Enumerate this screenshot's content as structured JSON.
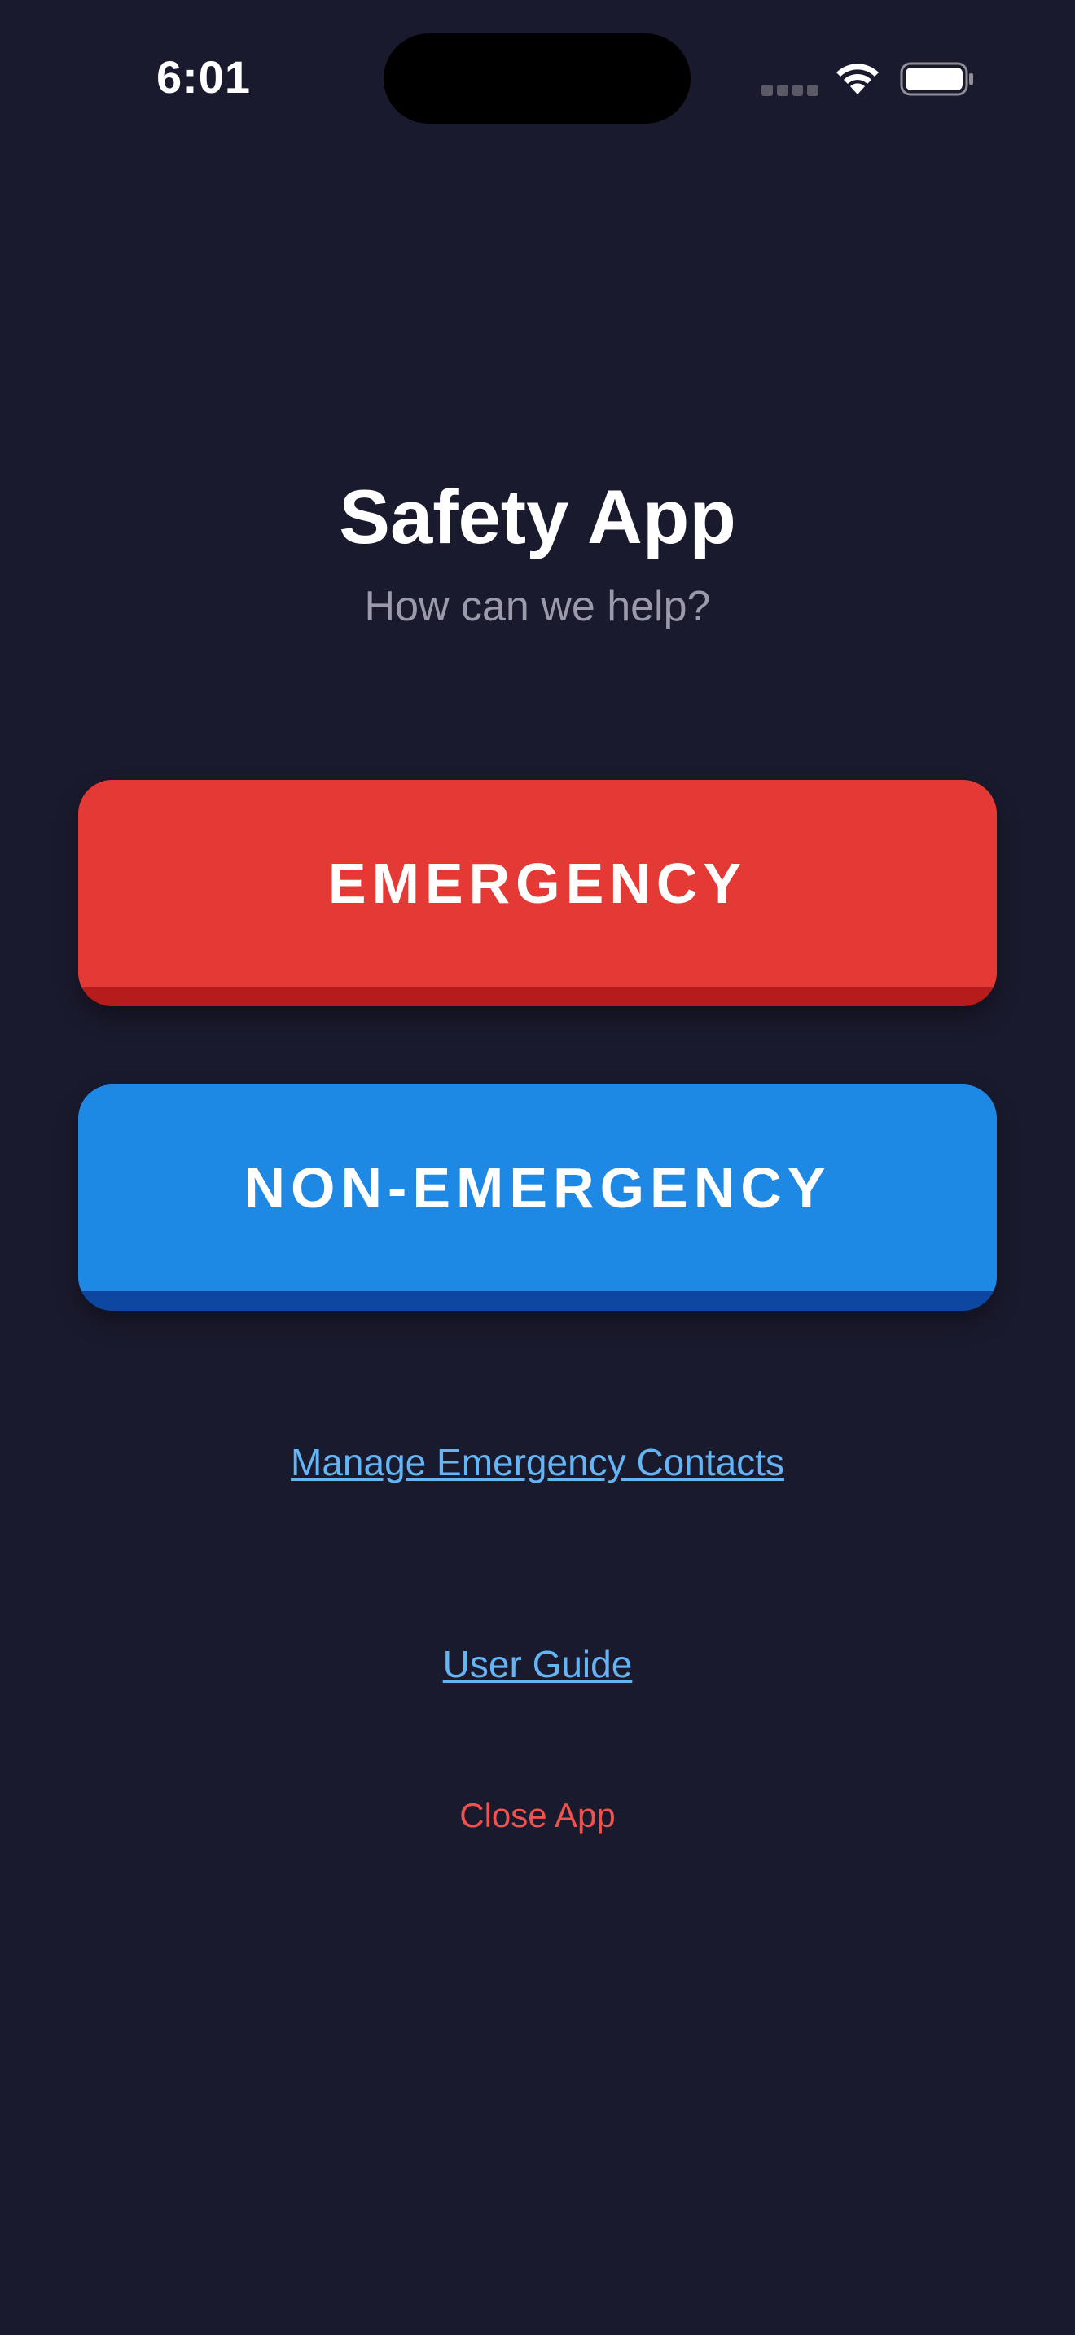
{
  "status_bar": {
    "time": "6:01",
    "icons": [
      "cellular-signal-icon",
      "wifi-icon",
      "battery-icon"
    ]
  },
  "header": {
    "title": "Safety App",
    "subtitle": "How can we help?"
  },
  "actions": {
    "emergency_label": "EMERGENCY",
    "non_emergency_label": "NON-EMERGENCY"
  },
  "links": {
    "manage_contacts": "Manage Emergency Contacts",
    "user_guide": "User Guide",
    "close_app": "Close App"
  },
  "colors": {
    "background": "#1a1a2e",
    "emergency": "#e53935",
    "non_emergency": "#1e88e5",
    "link": "#64b5f6",
    "close": "#ef5350"
  }
}
